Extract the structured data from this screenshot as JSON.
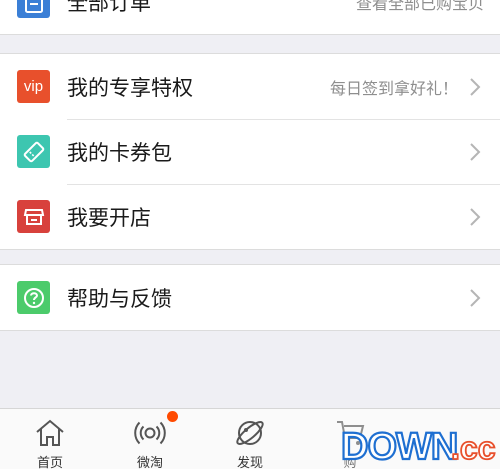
{
  "orders": {
    "label": "全部订单",
    "hint": "查看全部已购宝贝"
  },
  "section2": {
    "items": [
      {
        "label": "我的专享特权",
        "hint": "每日签到拿好礼！",
        "icon": "vip-icon",
        "color": "#e8502c",
        "icon_text": "vip"
      },
      {
        "label": "我的卡券包",
        "icon": "ticket-icon",
        "color": "#3dc6b0"
      },
      {
        "label": "我要开店",
        "icon": "shop-icon",
        "color": "#d8413c"
      }
    ]
  },
  "section3": {
    "items": [
      {
        "label": "帮助与反馈",
        "icon": "help-icon",
        "color": "#4ccb6b"
      }
    ]
  },
  "tabbar": {
    "tabs": [
      {
        "label": "首页",
        "icon": "home-icon"
      },
      {
        "label": "微淘",
        "icon": "broadcast-icon"
      },
      {
        "label": "发现",
        "icon": "planet-icon"
      },
      {
        "label": "购",
        "icon": "cart-icon"
      }
    ]
  },
  "watermark": {
    "text": "DOWN.cc"
  },
  "colors": {
    "background": "#efeff4",
    "badge": "#ff4a00",
    "watermark_blue": "#1e6fd1"
  }
}
